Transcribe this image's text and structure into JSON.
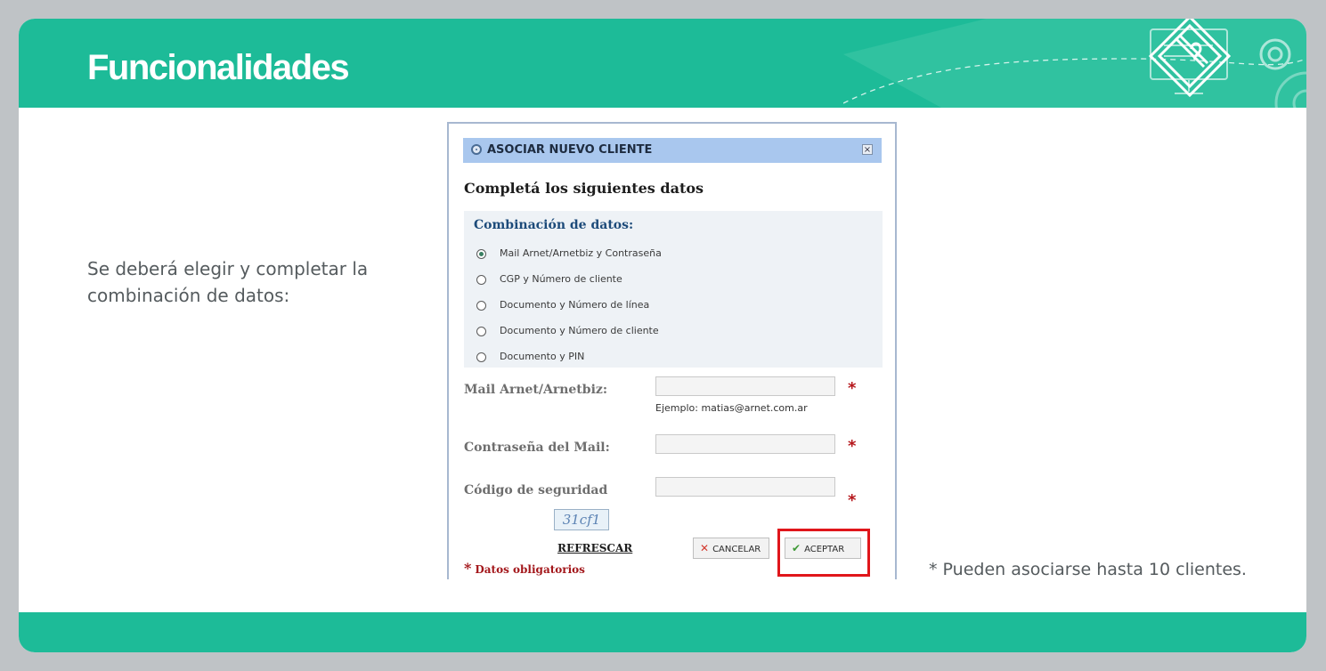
{
  "header": {
    "title": "Funcionalidades"
  },
  "description": "Se deberá elegir y completar la combinación de datos:",
  "note": "* Pueden asociarse hasta 10 clientes.",
  "dialog": {
    "title": "ASOCIAR NUEVO CLIENTE",
    "close_label": "×",
    "subtitle": "Completá los siguientes datos",
    "combination": {
      "heading": "Combinación de datos:",
      "options": [
        {
          "label": "Mail Arnet/Arnetbiz y Contraseña",
          "selected": true
        },
        {
          "label": "CGP y Número de cliente",
          "selected": false
        },
        {
          "label": "Documento y Número de línea",
          "selected": false
        },
        {
          "label": "Documento y Número de cliente",
          "selected": false
        },
        {
          "label": "Documento y PIN",
          "selected": false
        }
      ]
    },
    "fields": {
      "mail_label": "Mail Arnet/Arnetbiz:",
      "mail_hint": "Ejemplo: matias@arnet.com.ar",
      "password_label": "Contraseña del Mail:",
      "security_label": "Código de seguridad",
      "required_mark": "*"
    },
    "captcha_text": "31cf1",
    "refresh_label": "REFRESCAR",
    "cancel_label": "CANCELAR",
    "accept_label": "ACEPTAR",
    "required_note": "Datos obligatorios"
  },
  "colors": {
    "brand_green": "#1dbb98",
    "required_red": "#b5161b",
    "highlight_red": "#e0161b",
    "dialog_title_bg": "#a9c7ee"
  }
}
